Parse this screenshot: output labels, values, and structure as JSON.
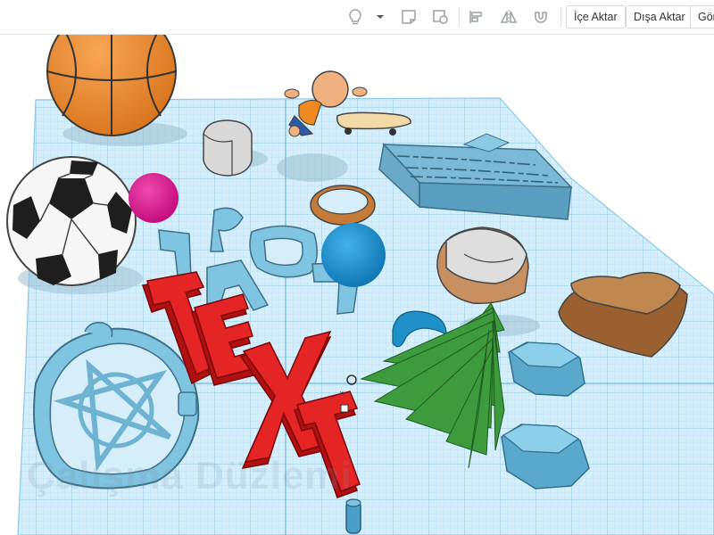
{
  "toolbar": {
    "light_icon": "lightbulb-icon",
    "note_icon": "note-icon",
    "view_icon": "view-icon",
    "align_icon": "align-icon",
    "mirror_icon": "mirror-icon",
    "magnet_icon": "magnet-icon",
    "import_label": "İçe Aktar",
    "export_label": "Dışa Aktar",
    "send_label": "Gön"
  },
  "workplane": {
    "watermark": "Çalışma Düzlemi",
    "grid_color": "#9fd4ec",
    "plane_color": "#cfeaf8"
  },
  "objects": [
    {
      "name": "basketball",
      "color": "#ef8a2e"
    },
    {
      "name": "soccer-ball",
      "color": "#ffffff"
    },
    {
      "name": "magenta-sphere",
      "color": "#e0148c"
    },
    {
      "name": "figure",
      "color": "#f0b080"
    },
    {
      "name": "skateboard",
      "color": "#f3d8a8"
    },
    {
      "name": "dice",
      "color": "#d8d8d8"
    },
    {
      "name": "ring",
      "color": "#d9894a"
    },
    {
      "name": "wood-box",
      "color": "#7ab9d8"
    },
    {
      "name": "blue-sphere",
      "color": "#1a8fd0"
    },
    {
      "name": "letters",
      "color": "#7fc4e0"
    },
    {
      "name": "dice-2",
      "color": "#d8d8d8"
    },
    {
      "name": "heart",
      "color": "#b97a40"
    },
    {
      "name": "text-3d",
      "color": "#e52020"
    },
    {
      "name": "tree",
      "color": "#3d9a3d"
    },
    {
      "name": "torus",
      "color": "#1f8fc8"
    },
    {
      "name": "gem-1",
      "color": "#7cc3e0"
    },
    {
      "name": "gem-2",
      "color": "#7cc3e0"
    },
    {
      "name": "cookie-cutter",
      "color": "#7fc4e0"
    },
    {
      "name": "peg",
      "color": "#4a9ec8"
    }
  ]
}
